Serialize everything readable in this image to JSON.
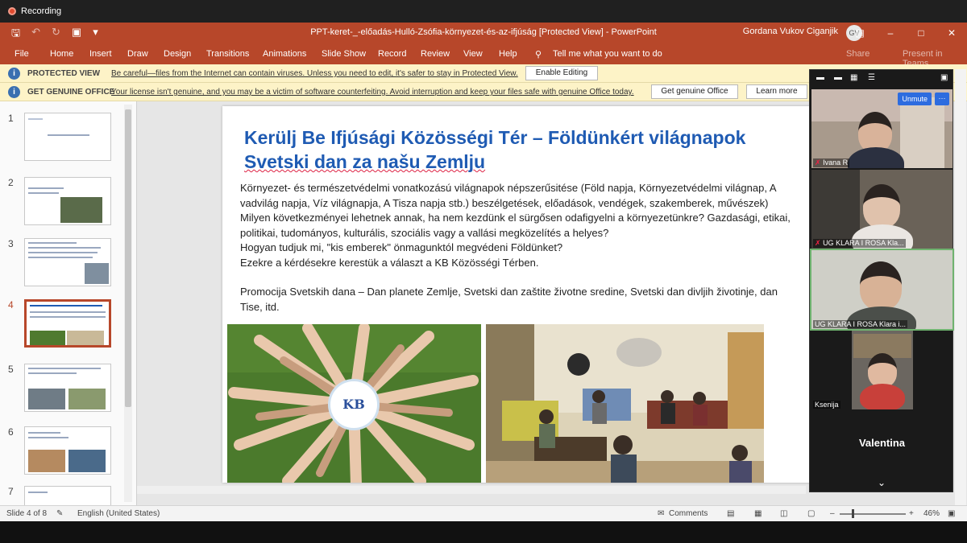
{
  "recording": {
    "label": "Recording"
  },
  "window": {
    "title": "PPT-keret-_-előadás-Hulló-Zsófia-környezet-és-az-ifjúság [Protected View]  -  PowerPoint",
    "user": "Gordana Vukov Ciganjik",
    "user_initials": "GV"
  },
  "ribbon": {
    "tabs": [
      "File",
      "Home",
      "Insert",
      "Draw",
      "Design",
      "Transitions",
      "Animations",
      "Slide Show",
      "Record",
      "Review",
      "View",
      "Help"
    ],
    "tell_me": "Tell me what you want to do",
    "share": "Share",
    "present": "Present in Teams"
  },
  "protected_bar": {
    "label": "PROTECTED VIEW",
    "message": "Be careful—files from the Internet can contain viruses. Unless you need to edit, it's safer to stay in Protected View.",
    "button": "Enable Editing"
  },
  "license_bar": {
    "label": "GET GENUINE OFFICE",
    "message": "Your license isn't genuine, and you may be a victim of software counterfeiting. Avoid interruption and keep your files safe with genuine Office today.",
    "button_primary": "Get genuine Office",
    "button_secondary": "Learn more"
  },
  "thumbnails": [
    "1",
    "2",
    "3",
    "4",
    "5",
    "6",
    "7"
  ],
  "slide": {
    "title_line1": "Kerülj Be Ifjúsági Közösségi Tér – Földünkért világnapok",
    "title_line2": "Svetski dan za našu Zemlju",
    "body": [
      "Környezet- és természetvédelmi vonatkozású világnapok népszerűsitése (Föld napja, Környezetvédelmi világnap, A",
      "vadvilág napja, Víz világnapja, A Tisza napja stb.) beszélgetések, előadások, vendégek, szakemberek, művészek)",
      "Milyen következményei lehetnek annak, ha nem kezdünk el sürgősen odafigyelni a környezetünkre? Gazdasági, etikai,",
      "politikai, tudományos, kulturális, szociális vagy a vallási megközelítés a helyes?",
      "Hogyan tudjuk mi, \"kis emberek\" önmagunktól megvédeni Földünket?",
      "Ezekre a kérdésekre kerestük a választ  a KB Közösségi Térben."
    ],
    "body2": [
      "Promocija Svetskih dana – Dan planete Zemlje, Svetski dan zaštite životne sredine, Svetski dan divljih životinje, dan",
      "Tise, itd."
    ],
    "logo_text": "KB"
  },
  "zoom": {
    "unmute": "Unmute",
    "more": "···",
    "participants": [
      "Ivana R",
      "UG KLARA I ROSA Kla...",
      "UG KLARA I ROSA Klara i...",
      "Ksenija"
    ],
    "speaker": "Valentina"
  },
  "status": {
    "slide": "Slide 4 of 8",
    "language": "English (United States)",
    "comments": "Comments",
    "zoom_level": "46%"
  },
  "colors": {
    "accent": "#b7472a",
    "title_blue": "#1f5bb3",
    "info_bar": "#fdf3c7"
  }
}
